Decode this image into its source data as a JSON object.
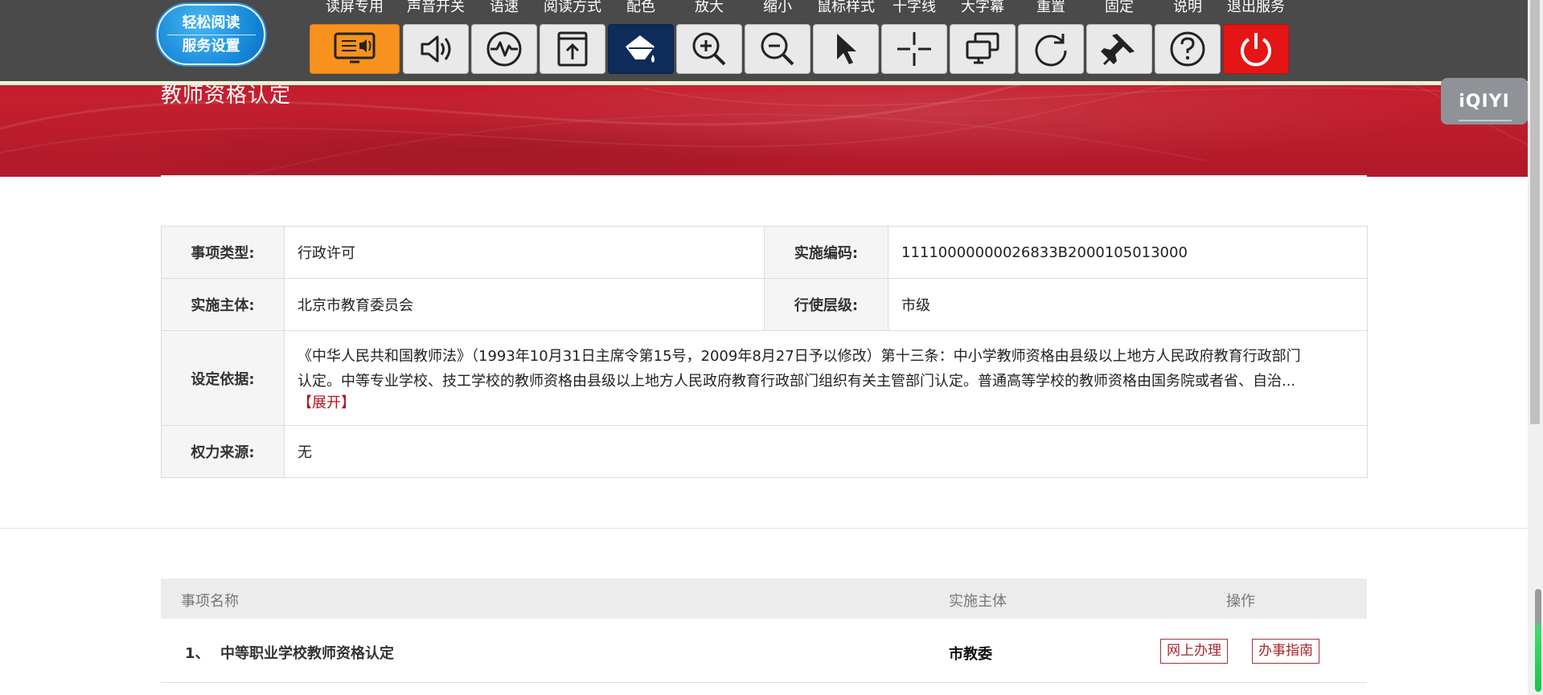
{
  "toolbar": {
    "logo_line1": "轻松阅读",
    "logo_line2": "服务设置",
    "buttons": [
      {
        "label": "读屏专用",
        "icon": "screen-reader-icon"
      },
      {
        "label": "声音开关",
        "icon": "speaker-icon"
      },
      {
        "label": "语速",
        "icon": "speed-wave-icon"
      },
      {
        "label": "阅读方式",
        "icon": "reading-mode-icon"
      },
      {
        "label": "配色",
        "icon": "color-bucket-icon"
      },
      {
        "label": "放大",
        "icon": "zoom-in-icon"
      },
      {
        "label": "缩小",
        "icon": "zoom-out-icon"
      },
      {
        "label": "鼠标样式",
        "icon": "cursor-icon"
      },
      {
        "label": "十字线",
        "icon": "crosshair-icon"
      },
      {
        "label": "大字幕",
        "icon": "caption-screen-icon"
      },
      {
        "label": "重置",
        "icon": "reset-icon"
      },
      {
        "label": "固定",
        "icon": "pin-icon"
      },
      {
        "label": "说明",
        "icon": "help-icon"
      },
      {
        "label": "退出服务",
        "icon": "power-icon"
      }
    ]
  },
  "iqiyi": {
    "text": "iQIYI"
  },
  "banner": {
    "title": "教师资格认定"
  },
  "info": {
    "type_label": "事项类型:",
    "type_value": "行政许可",
    "code_label": "实施编码:",
    "code_value": "11110000000026833B2000105013000",
    "subject_label": "实施主体:",
    "subject_value": "北京市教育委员会",
    "level_label": "行使层级:",
    "level_value": "市级",
    "basis_label": "设定依据:",
    "basis_line1": "《中华人民共和国教师法》（1993年10月31日主席令第15号，2009年8月27日予以修改）第十三条：中小学教师资格由县级以上地方人民政府教育行政部门",
    "basis_line2": "认定。中等专业学校、技工学校的教师资格由县级以上地方人民政府教育行政部门组织有关主管部门认定。普通高等学校的教师资格由国务院或者省、自治...",
    "basis_expand": "【展开】",
    "power_label": "权力来源:",
    "power_value": "无"
  },
  "list": {
    "headers": {
      "name": "事项名称",
      "entity": "实施主体",
      "action": "操作"
    },
    "rows": [
      {
        "index": "1、",
        "name": "中等职业学校教师资格认定",
        "entity": "市教委",
        "online": "网上办理",
        "guide": "办事指南"
      }
    ]
  },
  "colors": {
    "banner_red": "#c41f2f",
    "toolbar_bg": "#4a4a4a",
    "accent_orange": "#f7921e",
    "exit_red": "#e51515",
    "link_red": "#b2141e"
  }
}
